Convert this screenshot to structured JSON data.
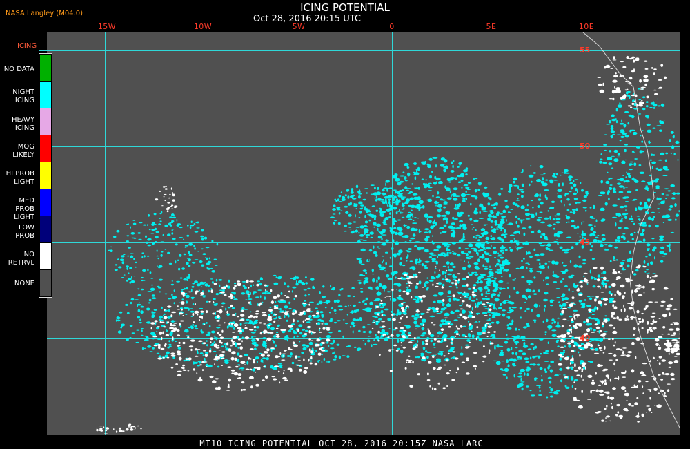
{
  "header": {
    "title": "ICING POTENTIAL",
    "subtitle": "Oct 28, 2016 20:15 UTC",
    "source": "NASA Langley (M04.0)"
  },
  "legend": {
    "label": "ICING",
    "items": [
      {
        "name": "NO DATA",
        "color": "#00b000"
      },
      {
        "name": "NIGHT ICING",
        "color": "#00ffff"
      },
      {
        "name": "HEAVY ICING",
        "color": "#e6a8e6"
      },
      {
        "name": "MOG LIKELY",
        "color": "#ff0000"
      },
      {
        "name": "HI PROB LIGHT",
        "color": "#ffff00"
      },
      {
        "name": "MED PROB LIGHT",
        "color": "#0000ff"
      },
      {
        "name": "LOW PROB",
        "color": "#00007a"
      },
      {
        "name": "NO RETRVL",
        "color": "#ffffff"
      },
      {
        "name": "NONE",
        "color": "#505050"
      }
    ]
  },
  "map": {
    "lon_labels": [
      "15W",
      "10W",
      "5W",
      "0",
      "5E",
      "10E"
    ],
    "lat_labels": [
      "55",
      "50",
      "45",
      "40"
    ],
    "graticule_color": "#2fd8d8",
    "background_color": "#505050"
  },
  "footer": {
    "text": "MT10  ICING POTENTIAL   OCT 28, 2016 20:15Z   NASA LARC"
  }
}
